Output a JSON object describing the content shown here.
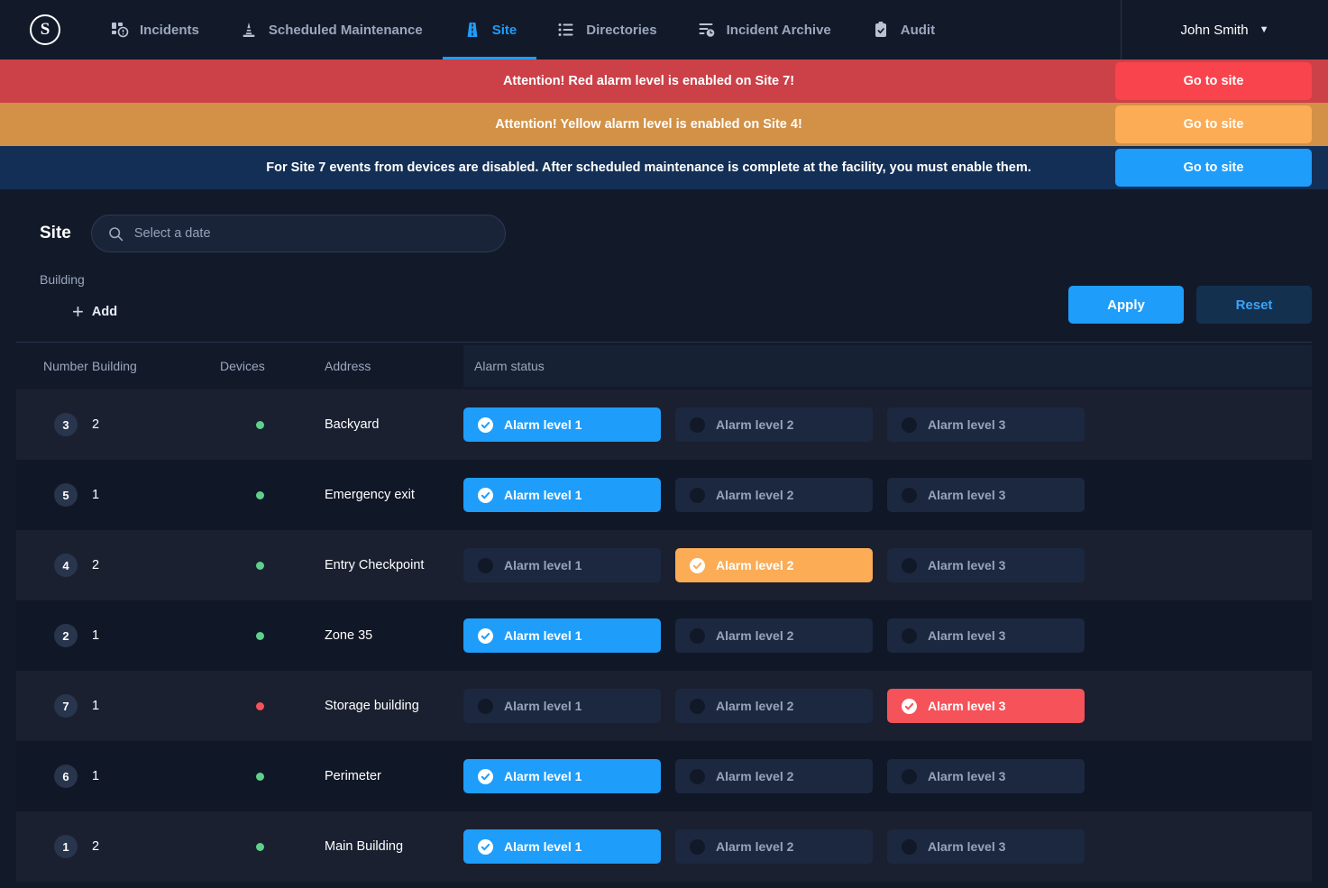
{
  "nav": {
    "logo": "S",
    "items": [
      {
        "label": "Incidents",
        "icon": "incidents-icon",
        "active": false
      },
      {
        "label": "Scheduled Maintenance",
        "icon": "cone-icon",
        "active": false
      },
      {
        "label": "Site",
        "icon": "site-road-icon",
        "active": true
      },
      {
        "label": "Directories",
        "icon": "list-icon",
        "active": false
      },
      {
        "label": "Incident Archive",
        "icon": "archive-clock-icon",
        "active": false
      },
      {
        "label": "Audit",
        "icon": "clipboard-check-icon",
        "active": false
      }
    ],
    "user": {
      "name": "John Smith",
      "caret": "▼"
    }
  },
  "banners": [
    {
      "text": "Attention! Red alarm level is enabled on Site 7!",
      "button": "Go to site",
      "level": "red",
      "bg": "#cc4048",
      "button_bg": "#f9444d"
    },
    {
      "text": "Attention! Yellow alarm level is enabled on Site 4!",
      "button": "Go to site",
      "level": "yellow",
      "bg": "#d29146",
      "button_bg": "#fbac55"
    },
    {
      "text": "For Site 7 events from devices are disabled. After scheduled maintenance is complete at the facility, you must enable them.",
      "button": "Go to site",
      "level": "info",
      "bg": "#142f56",
      "button_bg": "#1e9dfb"
    }
  ],
  "filters": {
    "title": "Site",
    "date_search": {
      "value": "",
      "placeholder": "Select a date",
      "icon": "search-icon"
    },
    "building_label": "Building",
    "add_button": "Add",
    "apply_button": "Apply",
    "reset_button": "Reset"
  },
  "table": {
    "headers": [
      "Number",
      "Building",
      "Devices",
      "Address",
      "Alarm status"
    ],
    "alarm_labels": [
      "Alarm level 1",
      "Alarm level 2",
      "Alarm level 3"
    ],
    "rows": [
      {
        "number": "3",
        "building": "2",
        "device_status": "green",
        "address": "Backyard",
        "alarm": 1
      },
      {
        "number": "5",
        "building": "1",
        "device_status": "green",
        "address": "Emergency exit",
        "alarm": 1
      },
      {
        "number": "4",
        "building": "2",
        "device_status": "green",
        "address": "Entry Checkpoint",
        "alarm": 2
      },
      {
        "number": "2",
        "building": "1",
        "device_status": "green",
        "address": "Zone 35",
        "alarm": 1
      },
      {
        "number": "7",
        "building": "1",
        "device_status": "red",
        "address": "Storage building",
        "alarm": 3
      },
      {
        "number": "6",
        "building": "1",
        "device_status": "green",
        "address": "Perimeter",
        "alarm": 1
      },
      {
        "number": "1",
        "building": "2",
        "device_status": "green",
        "address": "Main Building",
        "alarm": 1
      }
    ]
  },
  "colors": {
    "page_bg": "#121a2a",
    "accent": "#1e9dfb",
    "alarm_1": "#1e9dfb",
    "alarm_2": "#fbac55",
    "alarm_3": "#f5525a",
    "device_ok": "#5fd08c",
    "device_alert": "#f5525a"
  }
}
